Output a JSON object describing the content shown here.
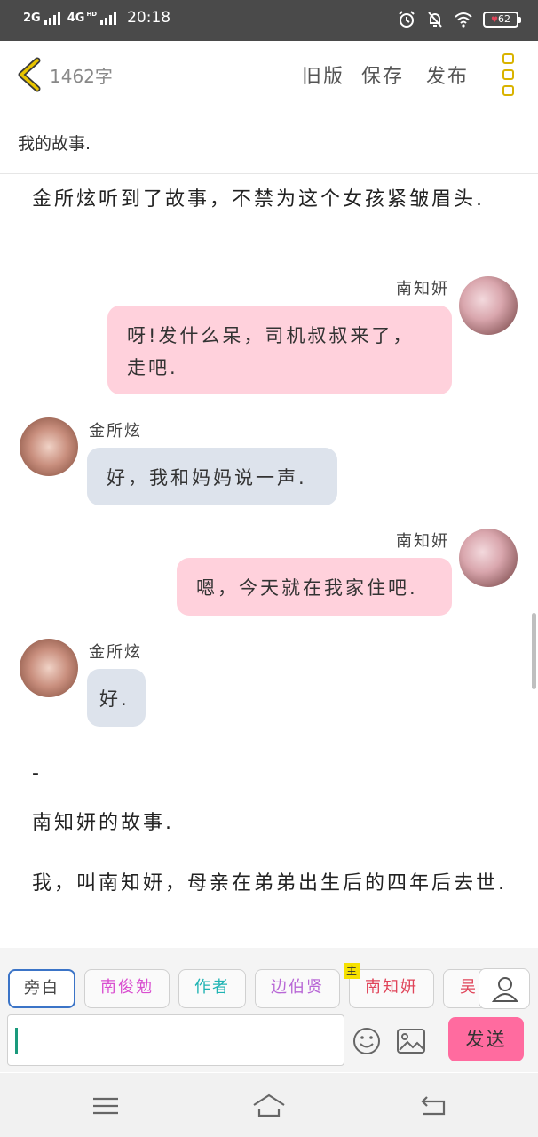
{
  "status_bar": {
    "network_1": "2G",
    "network_2": "4G",
    "network_2_sup": "HD",
    "time": "20:18",
    "battery": "62"
  },
  "header": {
    "word_count": "1462字",
    "old_version": "旧版",
    "save": "保存",
    "publish": "发布"
  },
  "story_title": "我的故事.",
  "content": {
    "para_1": "金所炫听到了故事，不禁为这个女孩紧皱眉头.",
    "msg_1": {
      "speaker": "南知妍",
      "text": "呀!发什么呆，司机叔叔来了，走吧."
    },
    "msg_2": {
      "speaker": "金所炫",
      "text": "好，我和妈妈说一声."
    },
    "msg_3": {
      "speaker": "南知妍",
      "text": "嗯，今天就在我家住吧."
    },
    "msg_4": {
      "speaker": "金所炫",
      "text": "好."
    },
    "dash": "-",
    "para_2": "南知妍的故事.",
    "para_3": "我，叫南知妍，母亲在弟弟出生后的四年后去世."
  },
  "roles": [
    {
      "label": "旁白",
      "color": "#444444"
    },
    {
      "label": "南俊勉",
      "color": "#d94fd0"
    },
    {
      "label": "作者",
      "color": "#1fb3b3"
    },
    {
      "label": "边伯贤",
      "color": "#b867d6"
    },
    {
      "label": "南知妍",
      "color": "#e0455a",
      "badge": "主"
    },
    {
      "label": "吴",
      "color": "#e0455a"
    }
  ],
  "composer": {
    "input_value": "",
    "send": "发送"
  },
  "colors": {
    "accent_yellow": "#d9b300",
    "bubble_self": "#ffd1dc",
    "bubble_other": "#dde3ec",
    "send_button": "#ff6b9f"
  }
}
